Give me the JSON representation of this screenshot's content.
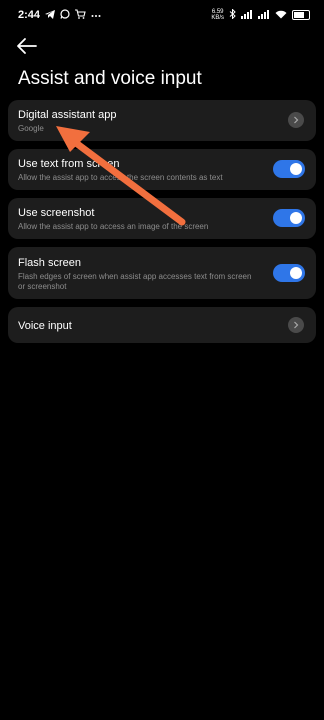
{
  "status_bar": {
    "time": "2:44",
    "left_icons": [
      "telegram-icon",
      "whatsapp-icon",
      "cart-icon",
      "more-dots-icon"
    ],
    "network_speed_value": "6.59",
    "network_speed_unit": "KB/s",
    "right_icons": [
      "bluetooth-icon",
      "signal-icon",
      "signal-icon",
      "wifi-icon",
      "battery-icon"
    ]
  },
  "header": {
    "back_icon": "back-arrow-icon",
    "title": "Assist and voice input"
  },
  "settings": [
    {
      "label": "Digital assistant app",
      "sub": "Google",
      "control": "chevron"
    },
    {
      "label": "Use text from screen",
      "sub": "Allow the assist app to access the screen contents as text",
      "control": "toggle",
      "on": true
    },
    {
      "label": "Use screenshot",
      "sub": "Allow the assist app to access an image of the screen",
      "control": "toggle",
      "on": true
    },
    {
      "label": "Flash screen",
      "sub": "Flash edges of screen when assist app accesses text from screen or screenshot",
      "control": "toggle",
      "on": true
    },
    {
      "label": "Voice input",
      "sub": "",
      "control": "chevron"
    }
  ],
  "colors": {
    "background": "#000000",
    "card": "#1d1d1d",
    "toggle_on": "#2f76e8",
    "annotation_arrow": "#f26f3e"
  }
}
